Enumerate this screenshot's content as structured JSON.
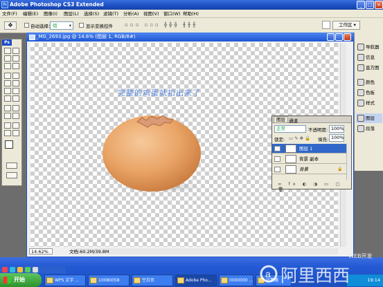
{
  "window": {
    "title": "Adobe Photoshop CS3 Extended",
    "controls": [
      "_",
      "□",
      "×"
    ]
  },
  "menu": [
    "文件(F)",
    "编辑(E)",
    "图像(I)",
    "图层(L)",
    "选择(S)",
    "滤镜(T)",
    "分析(A)",
    "视图(V)",
    "窗口(W)",
    "帮助(H)"
  ],
  "options": {
    "auto_select_label": "自动选择：",
    "auto_select_value": "组",
    "transform_label": "显示变换控件",
    "workspace_label": "工作区 ▾"
  },
  "toolbox": {
    "tab_label": "Ps"
  },
  "document": {
    "title": "_MG_2693.jpg @ 14.6% (图层 1, RGB/8#)",
    "zoom": "14.62%",
    "docsize": "文档:60.2M/39.8M"
  },
  "canvas_text": "完整的鸡蛋就扣出来了",
  "dock": [
    {
      "label": "导航器"
    },
    {
      "label": "信息"
    },
    {
      "label": "直方图"
    },
    {
      "label": "颜色"
    },
    {
      "label": "色板"
    },
    {
      "label": "样式"
    },
    {
      "label": "图层"
    },
    {
      "label": "段落"
    }
  ],
  "layers_panel": {
    "tabs": [
      "图层",
      "通道"
    ],
    "blend_mode": "正常",
    "opacity_label": "不透明度:",
    "opacity_value": "100%",
    "lock_label": "锁定:",
    "fill_label": "填充:",
    "fill_value": "100%",
    "layers": [
      {
        "name": "图层 1"
      },
      {
        "name": "背景 副本"
      },
      {
        "name": "背景"
      }
    ]
  },
  "taskbar": {
    "start_label": "开始",
    "tasks": [
      "WPS 文字 ...",
      "10080058",
      "空白页",
      "Adobe Pho...",
      "0000000 ...",
      "计算器"
    ],
    "time": "19:14"
  },
  "watermark": {
    "brand": "阿里西西",
    "tag": "WEB开发"
  }
}
